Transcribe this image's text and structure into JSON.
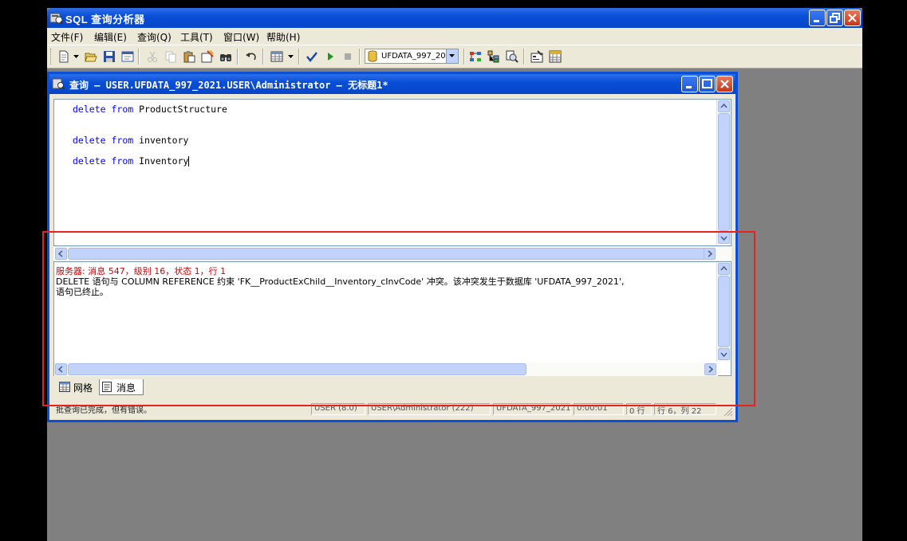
{
  "app": {
    "title": "SQL 查询分析器",
    "menu": [
      "文件(F)",
      "编辑(E)",
      "查询(Q)",
      "工具(T)",
      "窗口(W)",
      "帮助(H)"
    ],
    "database_select": "UFDATA_997_20"
  },
  "query_window": {
    "title": "查询 — USER.UFDATA_997_2021.USER\\Administrator — 无标题1*",
    "sql_lines": [
      {
        "kw1": "delete",
        "kw2": "from",
        "table": "ProductStructure"
      },
      {
        "kw1": "delete",
        "kw2": "from",
        "table": "inventory"
      },
      {
        "kw1": "delete",
        "kw2": "from",
        "table": "Inventory"
      }
    ]
  },
  "results": {
    "error_line": "服务器: 消息 547，级别 16，状态 1，行 1",
    "message_line": "DELETE 语句与 COLUMN REFERENCE 约束 'FK__ProductExChild__Inventory_cInvCode' 冲突。该冲突发生于数据库 'UFDATA_997_2021',",
    "terminated_line": "语句已终止。"
  },
  "tabs": {
    "grid": "网格",
    "messages": "消息"
  },
  "status": {
    "message": "批查询已完成，但有错误。",
    "server": "USER (8.0)",
    "user": "USER\\Administrator (222)",
    "database": "UFDATA_997_2021",
    "time": "0:00:01",
    "rows": "0 行",
    "position": "行 6，列 22"
  },
  "colors": {
    "titlebar": "#0a4fd8",
    "highlight_box": "#e8231e",
    "error_text": "#d00000",
    "keyword": "#0000ff"
  }
}
